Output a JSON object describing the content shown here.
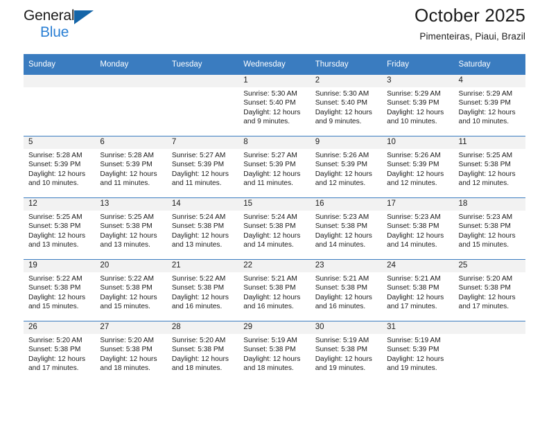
{
  "brand": {
    "name_part1": "General",
    "name_part2": "Blue",
    "triangle_icon": "triangle-icon",
    "accent_color": "#2a7fd4",
    "header_color": "#3a7cc0"
  },
  "header": {
    "title": "October 2025",
    "subtitle": "Pimenteiras, Piaui, Brazil"
  },
  "calendar": {
    "weekday_headers": [
      "Sunday",
      "Monday",
      "Tuesday",
      "Wednesday",
      "Thursday",
      "Friday",
      "Saturday"
    ],
    "weeks": [
      [
        {
          "day": "",
          "empty": true
        },
        {
          "day": "",
          "empty": true
        },
        {
          "day": "",
          "empty": true
        },
        {
          "day": "1",
          "sunrise": "Sunrise: 5:30 AM",
          "sunset": "Sunset: 5:40 PM",
          "daylight": "Daylight: 12 hours and 9 minutes."
        },
        {
          "day": "2",
          "sunrise": "Sunrise: 5:30 AM",
          "sunset": "Sunset: 5:40 PM",
          "daylight": "Daylight: 12 hours and 9 minutes."
        },
        {
          "day": "3",
          "sunrise": "Sunrise: 5:29 AM",
          "sunset": "Sunset: 5:39 PM",
          "daylight": "Daylight: 12 hours and 10 minutes."
        },
        {
          "day": "4",
          "sunrise": "Sunrise: 5:29 AM",
          "sunset": "Sunset: 5:39 PM",
          "daylight": "Daylight: 12 hours and 10 minutes."
        }
      ],
      [
        {
          "day": "5",
          "sunrise": "Sunrise: 5:28 AM",
          "sunset": "Sunset: 5:39 PM",
          "daylight": "Daylight: 12 hours and 10 minutes."
        },
        {
          "day": "6",
          "sunrise": "Sunrise: 5:28 AM",
          "sunset": "Sunset: 5:39 PM",
          "daylight": "Daylight: 12 hours and 11 minutes."
        },
        {
          "day": "7",
          "sunrise": "Sunrise: 5:27 AM",
          "sunset": "Sunset: 5:39 PM",
          "daylight": "Daylight: 12 hours and 11 minutes."
        },
        {
          "day": "8",
          "sunrise": "Sunrise: 5:27 AM",
          "sunset": "Sunset: 5:39 PM",
          "daylight": "Daylight: 12 hours and 11 minutes."
        },
        {
          "day": "9",
          "sunrise": "Sunrise: 5:26 AM",
          "sunset": "Sunset: 5:39 PM",
          "daylight": "Daylight: 12 hours and 12 minutes."
        },
        {
          "day": "10",
          "sunrise": "Sunrise: 5:26 AM",
          "sunset": "Sunset: 5:39 PM",
          "daylight": "Daylight: 12 hours and 12 minutes."
        },
        {
          "day": "11",
          "sunrise": "Sunrise: 5:25 AM",
          "sunset": "Sunset: 5:38 PM",
          "daylight": "Daylight: 12 hours and 12 minutes."
        }
      ],
      [
        {
          "day": "12",
          "sunrise": "Sunrise: 5:25 AM",
          "sunset": "Sunset: 5:38 PM",
          "daylight": "Daylight: 12 hours and 13 minutes."
        },
        {
          "day": "13",
          "sunrise": "Sunrise: 5:25 AM",
          "sunset": "Sunset: 5:38 PM",
          "daylight": "Daylight: 12 hours and 13 minutes."
        },
        {
          "day": "14",
          "sunrise": "Sunrise: 5:24 AM",
          "sunset": "Sunset: 5:38 PM",
          "daylight": "Daylight: 12 hours and 13 minutes."
        },
        {
          "day": "15",
          "sunrise": "Sunrise: 5:24 AM",
          "sunset": "Sunset: 5:38 PM",
          "daylight": "Daylight: 12 hours and 14 minutes."
        },
        {
          "day": "16",
          "sunrise": "Sunrise: 5:23 AM",
          "sunset": "Sunset: 5:38 PM",
          "daylight": "Daylight: 12 hours and 14 minutes."
        },
        {
          "day": "17",
          "sunrise": "Sunrise: 5:23 AM",
          "sunset": "Sunset: 5:38 PM",
          "daylight": "Daylight: 12 hours and 14 minutes."
        },
        {
          "day": "18",
          "sunrise": "Sunrise: 5:23 AM",
          "sunset": "Sunset: 5:38 PM",
          "daylight": "Daylight: 12 hours and 15 minutes."
        }
      ],
      [
        {
          "day": "19",
          "sunrise": "Sunrise: 5:22 AM",
          "sunset": "Sunset: 5:38 PM",
          "daylight": "Daylight: 12 hours and 15 minutes."
        },
        {
          "day": "20",
          "sunrise": "Sunrise: 5:22 AM",
          "sunset": "Sunset: 5:38 PM",
          "daylight": "Daylight: 12 hours and 15 minutes."
        },
        {
          "day": "21",
          "sunrise": "Sunrise: 5:22 AM",
          "sunset": "Sunset: 5:38 PM",
          "daylight": "Daylight: 12 hours and 16 minutes."
        },
        {
          "day": "22",
          "sunrise": "Sunrise: 5:21 AM",
          "sunset": "Sunset: 5:38 PM",
          "daylight": "Daylight: 12 hours and 16 minutes."
        },
        {
          "day": "23",
          "sunrise": "Sunrise: 5:21 AM",
          "sunset": "Sunset: 5:38 PM",
          "daylight": "Daylight: 12 hours and 16 minutes."
        },
        {
          "day": "24",
          "sunrise": "Sunrise: 5:21 AM",
          "sunset": "Sunset: 5:38 PM",
          "daylight": "Daylight: 12 hours and 17 minutes."
        },
        {
          "day": "25",
          "sunrise": "Sunrise: 5:20 AM",
          "sunset": "Sunset: 5:38 PM",
          "daylight": "Daylight: 12 hours and 17 minutes."
        }
      ],
      [
        {
          "day": "26",
          "sunrise": "Sunrise: 5:20 AM",
          "sunset": "Sunset: 5:38 PM",
          "daylight": "Daylight: 12 hours and 17 minutes."
        },
        {
          "day": "27",
          "sunrise": "Sunrise: 5:20 AM",
          "sunset": "Sunset: 5:38 PM",
          "daylight": "Daylight: 12 hours and 18 minutes."
        },
        {
          "day": "28",
          "sunrise": "Sunrise: 5:20 AM",
          "sunset": "Sunset: 5:38 PM",
          "daylight": "Daylight: 12 hours and 18 minutes."
        },
        {
          "day": "29",
          "sunrise": "Sunrise: 5:19 AM",
          "sunset": "Sunset: 5:38 PM",
          "daylight": "Daylight: 12 hours and 18 minutes."
        },
        {
          "day": "30",
          "sunrise": "Sunrise: 5:19 AM",
          "sunset": "Sunset: 5:38 PM",
          "daylight": "Daylight: 12 hours and 19 minutes."
        },
        {
          "day": "31",
          "sunrise": "Sunrise: 5:19 AM",
          "sunset": "Sunset: 5:39 PM",
          "daylight": "Daylight: 12 hours and 19 minutes."
        },
        {
          "day": "",
          "empty": true
        }
      ]
    ]
  }
}
